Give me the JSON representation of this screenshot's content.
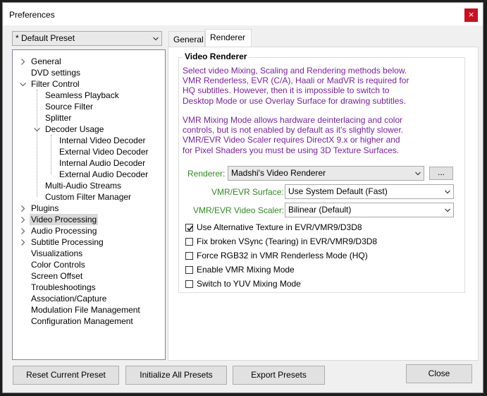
{
  "window": {
    "title": "Preferences",
    "close_glyph": "×"
  },
  "preset": {
    "selected": "* Default Preset"
  },
  "tree": [
    {
      "label": "General",
      "level": 0,
      "toggle": "collapsed"
    },
    {
      "label": "DVD settings",
      "level": 0,
      "toggle": "none"
    },
    {
      "label": "Filter Control",
      "level": 0,
      "toggle": "expanded"
    },
    {
      "label": "Seamless Playback",
      "level": 1,
      "toggle": "none"
    },
    {
      "label": "Source Filter",
      "level": 1,
      "toggle": "none"
    },
    {
      "label": "Splitter",
      "level": 1,
      "toggle": "none"
    },
    {
      "label": "Decoder Usage",
      "level": 1,
      "toggle": "expanded"
    },
    {
      "label": "Internal Video Decoder",
      "level": 2,
      "toggle": "none"
    },
    {
      "label": "External Video Decoder",
      "level": 2,
      "toggle": "none"
    },
    {
      "label": "Internal Audio Decoder",
      "level": 2,
      "toggle": "none"
    },
    {
      "label": "External Audio Decoder",
      "level": 2,
      "toggle": "none"
    },
    {
      "label": "Multi-Audio Streams",
      "level": 1,
      "toggle": "none"
    },
    {
      "label": "Custom Filter Manager",
      "level": 1,
      "toggle": "none"
    },
    {
      "label": "Plugins",
      "level": 0,
      "toggle": "collapsed"
    },
    {
      "label": "Video Processing",
      "level": 0,
      "toggle": "collapsed",
      "selected": true
    },
    {
      "label": "Audio Processing",
      "level": 0,
      "toggle": "collapsed"
    },
    {
      "label": "Subtitle Processing",
      "level": 0,
      "toggle": "collapsed"
    },
    {
      "label": "Visualizations",
      "level": 0,
      "toggle": "none"
    },
    {
      "label": "Color Controls",
      "level": 0,
      "toggle": "none"
    },
    {
      "label": "Screen Offset",
      "level": 0,
      "toggle": "none"
    },
    {
      "label": "Troubleshootings",
      "level": 0,
      "toggle": "none"
    },
    {
      "label": "Association/Capture",
      "level": 0,
      "toggle": "none"
    },
    {
      "label": "Modulation File Management",
      "level": 0,
      "toggle": "none"
    },
    {
      "label": "Configuration Management",
      "level": 0,
      "toggle": "none"
    }
  ],
  "tabs": {
    "general": "General",
    "renderer": "Renderer"
  },
  "renderer_panel": {
    "group_title": "Video Renderer",
    "description_1": [
      "Select video Mixing, Scaling and Rendering methods below.",
      "VMR Renderless, EVR (C/A), Haali or MadVR is required for",
      "HQ subtitles. However, then it is impossible to switch to",
      "Desktop Mode or use Overlay Surface for drawing subtitles."
    ],
    "description_2": [
      "VMR Mixing Mode allows hardware deinterlacing and color",
      "controls, but is not enabled by default as it's slightly slower.",
      "VMR/EVR Video Scaler requires DirectX 9.x or higher and",
      "for Pixel Shaders you must be using 3D Texture Surfaces."
    ],
    "renderer_label": "Renderer:",
    "renderer_value": "Madshi's Video Renderer",
    "more_button": "...",
    "surface_label": "VMR/EVR Surface:",
    "surface_value": "Use System Default (Fast)",
    "scaler_label": "VMR/EVR Video Scaler:",
    "scaler_value": "Bilinear (Default)",
    "checkboxes": [
      {
        "label": "Use Alternative Texture in EVR/VMR9/D3D8",
        "checked": true
      },
      {
        "label": "Fix broken VSync (Tearing) in EVR/VMR9/D3D8",
        "checked": false
      },
      {
        "label": "Force RGB32 in VMR Renderless Mode (HQ)",
        "checked": false
      },
      {
        "label": "Enable VMR Mixing Mode",
        "checked": false
      },
      {
        "label": "Switch to YUV Mixing Mode",
        "checked": false
      }
    ]
  },
  "footer": {
    "reset": "Reset Current Preset",
    "initialize": "Initialize All Presets",
    "export": "Export Presets",
    "close": "Close"
  },
  "colors": {
    "description": "#7b1fa2",
    "label_green": "#2e8b1f",
    "close_red": "#c8101e"
  }
}
